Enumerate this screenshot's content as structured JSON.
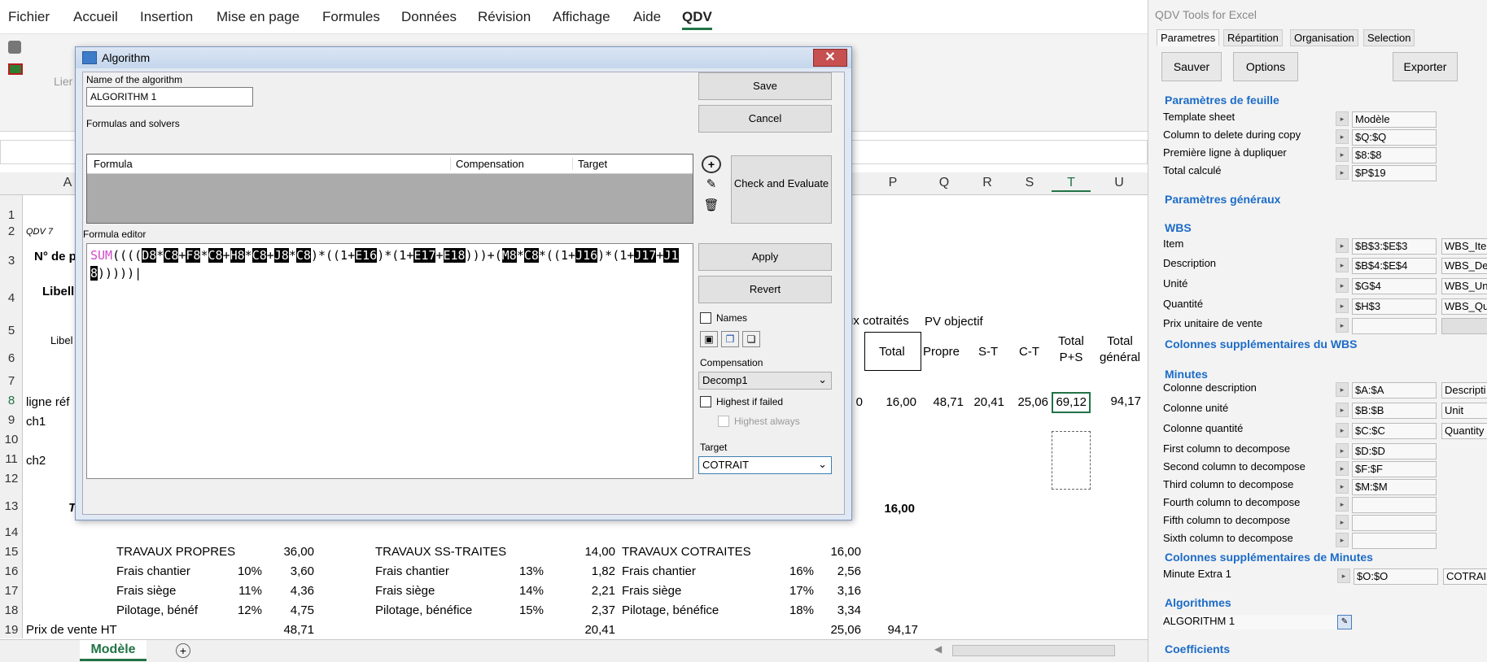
{
  "ribbon": {
    "tabs": [
      "Fichier",
      "Accueil",
      "Insertion",
      "Mise en page",
      "Formules",
      "Données",
      "Révision",
      "Affichage",
      "Aide",
      "QDV"
    ],
    "partial_label": "Lier"
  },
  "sheet": {
    "columns": [
      "A",
      "P",
      "Q",
      "R",
      "S",
      "T",
      "U"
    ],
    "rows": [
      "1",
      "2",
      "3",
      "4",
      "5",
      "6",
      "7",
      "8",
      "9",
      "10",
      "11",
      "12",
      "13",
      "14",
      "15",
      "16",
      "17",
      "18",
      "19"
    ],
    "cells": {
      "a2": "QDV 7",
      "a3": "N° de p",
      "a4": "Libell",
      "a6": "Libel",
      "a8": "ligne réf",
      "a9": "ch1",
      "a11": "ch2",
      "a13": "T",
      "hdr_cotraites": "ux cotraités",
      "hdr_pv": "PV objectif",
      "hdr_total": "Total",
      "hdr_propre": "Propre",
      "hdr_st": "S-T",
      "hdr_ct": "C-T",
      "hdr_totalps": "Total P+S",
      "hdr_totalgen": "Total général",
      "r8_o": "0",
      "r8_p": "16,00",
      "r8_q": "48,71",
      "r8_r": "20,41",
      "r8_s": "25,06",
      "r8_t": "69,12",
      "r8_u": "94,17",
      "r13_p": "16,00",
      "travaux_propres": "TRAVAUX PROPRES",
      "travaux_propres_val": "36,00",
      "travaux_ss": "TRAVAUX SS-TRAITES",
      "travaux_ss_val": "14,00",
      "travaux_cot": "TRAVAUX COTRAITES",
      "travaux_cot_val": "16,00",
      "frais_chantier": "Frais chantier",
      "frais_siege": "Frais siège",
      "pilotage_short": "Pilotage, bénéf",
      "pilotage": "Pilotage, bénéfice",
      "p16_pct": "10%",
      "p16_val": "3,60",
      "p17_pct": "11%",
      "p17_val": "4,36",
      "p18_pct": "12%",
      "p18_val": "4,75",
      "s16_pct": "13%",
      "s16_val": "1,82",
      "s17_pct": "14%",
      "s17_val": "2,21",
      "s18_pct": "15%",
      "s18_val": "2,37",
      "c16_pct": "16%",
      "c16_val": "2,56",
      "c17_pct": "17%",
      "c17_val": "3,16",
      "c18_pct": "18%",
      "c18_val": "3,34",
      "r19_label": "Prix de vente HT",
      "r19_p": "48,71",
      "r19_s": "20,41",
      "r19_c": "25,06",
      "r19_tot": "94,17"
    },
    "sheet_tab": "Modèle",
    "colors": {
      "yellow": "#ffff00",
      "peach": "#f8cbad",
      "green": "#a9d18e",
      "orange": "#f4b183"
    }
  },
  "dialog": {
    "title": "Algorithm",
    "name_label": "Name of the algorithm",
    "name_value": "ALGORITHM 1",
    "formulas_label": "Formulas and solvers",
    "table_headers": [
      "Formula",
      "Compensation",
      "Target"
    ],
    "editor_label": "Formula editor",
    "save": "Save",
    "cancel": "Cancel",
    "check": "Check and Evaluate",
    "apply": "Apply",
    "revert": "Revert",
    "names": "Names",
    "compensation_label": "Compensation",
    "compensation_value": "Decomp1",
    "highest_if_failed": "Highest if failed",
    "highest_always": "Highest always",
    "target_label": "Target",
    "target_value": "COTRAIT"
  },
  "panel": {
    "title": "QDV Tools for Excel",
    "tabs": [
      "Parametres",
      "Répartition",
      "Organisation",
      "Selection"
    ],
    "buttons": [
      "Sauver",
      "Options",
      "Exporter"
    ],
    "sec_feuille": "Paramètres de feuille",
    "feuille": [
      {
        "label": "Template sheet",
        "value": "Modèle"
      },
      {
        "label": "Column to delete during copy",
        "value": "$Q:$Q"
      },
      {
        "label": "Première ligne à dupliquer",
        "value": "$8:$8"
      },
      {
        "label": "Total calculé",
        "value": "$P$19"
      }
    ],
    "sec_generaux": "Paramètres généraux",
    "sec_wbs": "WBS",
    "wbs": [
      {
        "label": "Item",
        "value": "$B$3:$E$3",
        "extra": "WBS_Ite"
      },
      {
        "label": "Description",
        "value": "$B$4:$E$4",
        "extra": "WBS_De"
      },
      {
        "label": "Unité",
        "value": "$G$4",
        "extra": "WBS_Un"
      },
      {
        "label": "Quantité",
        "value": "$H$3",
        "extra": "WBS_Qu"
      },
      {
        "label": "Prix unitaire de vente",
        "value": "",
        "extra": ""
      }
    ],
    "sec_col_wbs": "Colonnes supplémentaires du WBS",
    "sec_minutes": "Minutes",
    "minutes": [
      {
        "label": "Colonne description",
        "value": "$A:$A",
        "extra": "Descripti"
      },
      {
        "label": "Colonne unité",
        "value": "$B:$B",
        "extra": "Unit"
      },
      {
        "label": "Colonne quantité",
        "value": "$C:$C",
        "extra": "Quantity"
      },
      {
        "label": "First column to decompose",
        "value": "$D:$D",
        "extra": ""
      },
      {
        "label": "Second column to decompose",
        "value": "$F:$F",
        "extra": ""
      },
      {
        "label": "Third column to decompose",
        "value": "$M:$M",
        "extra": ""
      },
      {
        "label": "Fourth column to decompose",
        "value": "",
        "extra": ""
      },
      {
        "label": "Fifth column to decompose",
        "value": "",
        "extra": ""
      },
      {
        "label": "Sixth column to decompose",
        "value": "",
        "extra": ""
      }
    ],
    "sec_col_minutes": "Colonnes supplémentaires de Minutes",
    "minute_extra": {
      "label": "Minute Extra 1",
      "value": "$O:$O",
      "extra": "COTRAI"
    },
    "sec_algos": "Algorithmes",
    "algo_item": "ALGORITHM 1",
    "sec_coef": "Coefficients"
  }
}
